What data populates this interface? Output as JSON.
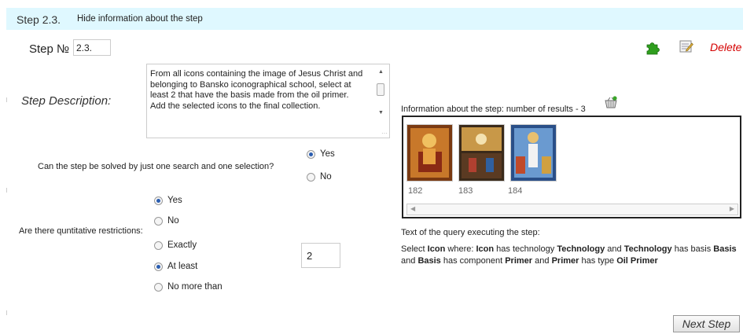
{
  "header": {
    "step_title": "Step 2.3.",
    "hide_link": "Hide information about the step"
  },
  "step_no": {
    "label": "Step № :",
    "value": "2.3."
  },
  "description": {
    "label": "Step Description:",
    "text": "From all icons containing the image of Jesus Christ and belonging to Bansko iconographical school, select at least 2 that have the basis made from the oil primer.\nAdd the selected icons to the final collection."
  },
  "question_single_search": {
    "label": "Can the step be solved by just one search and one selection?",
    "options": [
      "Yes",
      "No"
    ],
    "selected": "Yes"
  },
  "question_restrictions": {
    "label": "Are there quntitative restrictions:",
    "options": [
      "Yes",
      "No"
    ],
    "selected": "Yes"
  },
  "restriction_type": {
    "options": [
      "Exactly",
      "At least",
      "No more than"
    ],
    "selected": "At least",
    "value": "2"
  },
  "results": {
    "label": "Information about the step: number of results - 3",
    "items": [
      {
        "id": "182",
        "color": "#b5651d"
      },
      {
        "id": "183",
        "color": "#6b4a2a"
      },
      {
        "id": "184",
        "color": "#3a6fb0"
      }
    ]
  },
  "query": {
    "label": "Text of the query executing the step:",
    "text": "Select Icon where: Icon has technology Technology and Technology has basis Basis and Basis has component Primer and Primer has type Oil Primer"
  },
  "actions": {
    "delete_label": "Delete",
    "next_label": "Next Step"
  },
  "icons": {
    "add": "puzzle-icon",
    "edit": "edit-icon",
    "basket": "basket-icon"
  }
}
